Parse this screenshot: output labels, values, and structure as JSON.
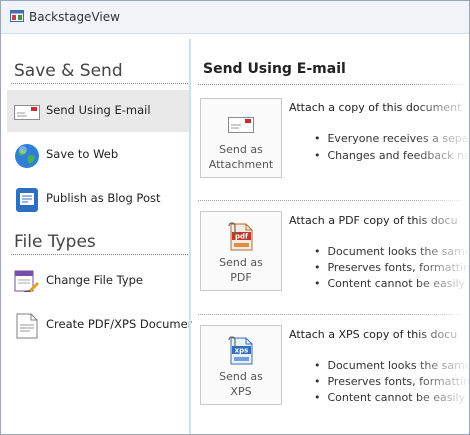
{
  "window": {
    "title": "BackstageView"
  },
  "left": {
    "section1": "Save & Send",
    "section2": "File Types",
    "items": [
      {
        "label": "Send Using E-mail",
        "icon": "email-envelope-icon",
        "selected": true
      },
      {
        "label": "Save to Web",
        "icon": "globe-icon",
        "selected": false
      },
      {
        "label": "Publish as Blog Post",
        "icon": "blog-post-icon",
        "selected": false
      },
      {
        "label": "Change File Type",
        "icon": "change-file-type-icon",
        "selected": false
      },
      {
        "label": "Create PDF/XPS Document",
        "icon": "create-pdf-xps-icon",
        "selected": false
      }
    ]
  },
  "right": {
    "title": "Send Using E-mail",
    "options": [
      {
        "button_line1": "Send as",
        "button_line2": "Attachment",
        "icon": "envelope-attachment-icon",
        "description": "Attach a copy of this document",
        "bullets": [
          "Everyone receives a separ",
          "Changes and feedback ne"
        ]
      },
      {
        "button_line1": "Send as",
        "button_line2": "PDF",
        "icon": "pdf-file-icon",
        "description": "Attach a PDF copy of this docu",
        "bullets": [
          "Document looks the same",
          "Preserves fonts, formattin",
          "Content cannot be easily"
        ]
      },
      {
        "button_line1": "Send as",
        "button_line2": "XPS",
        "icon": "xps-file-icon",
        "description": "Attach a XPS copy of this docu",
        "bullets": [
          "Document looks the same",
          "Preserves fonts, formattin",
          "Content cannot be easily"
        ]
      }
    ]
  }
}
